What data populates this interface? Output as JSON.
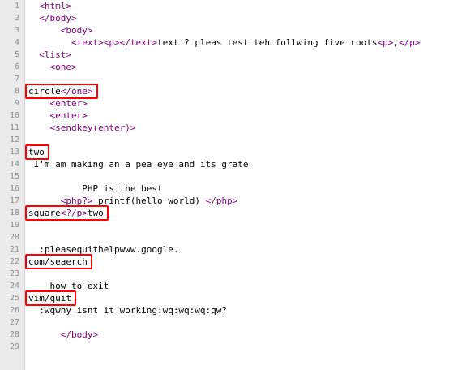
{
  "editor": {
    "colors": {
      "tag": "#800080",
      "text": "#000000",
      "line_number": "#8c8c8c",
      "highlight_box": "#ff0000",
      "gutter": "#ebebeb"
    },
    "highlighted_lines": [
      8,
      13,
      18,
      22,
      25
    ],
    "lines": [
      {
        "n": "1",
        "indent": "  ",
        "segs": [
          {
            "t": "<html>",
            "tag": true
          }
        ]
      },
      {
        "n": "2",
        "indent": "  ",
        "segs": [
          {
            "t": "</body>",
            "tag": true
          }
        ]
      },
      {
        "n": "3",
        "indent": "      ",
        "segs": [
          {
            "t": "<body>",
            "tag": true
          }
        ]
      },
      {
        "n": "4",
        "indent": "        ",
        "segs": [
          {
            "t": "<text>",
            "tag": true
          },
          {
            "t": "<p>",
            "tag": true
          },
          {
            "t": "</text>",
            "tag": true
          },
          {
            "t": "text ? pleas test teh follwing five roots",
            "tag": false
          },
          {
            "t": "<p>",
            "tag": true
          },
          {
            "t": ",",
            "tag": false
          },
          {
            "t": "</p>",
            "tag": true
          }
        ]
      },
      {
        "n": "5",
        "indent": "  ",
        "segs": [
          {
            "t": "<list>",
            "tag": true
          }
        ]
      },
      {
        "n": "6",
        "indent": "    ",
        "segs": [
          {
            "t": "<one>",
            "tag": true
          }
        ]
      },
      {
        "n": "7",
        "indent": "",
        "segs": []
      },
      {
        "n": "8",
        "indent": "",
        "segs": [
          {
            "t": "circle",
            "tag": false
          },
          {
            "t": "</one>",
            "tag": true
          }
        ]
      },
      {
        "n": "9",
        "indent": "    ",
        "segs": [
          {
            "t": "<enter>",
            "tag": true
          }
        ]
      },
      {
        "n": "10",
        "indent": "    ",
        "segs": [
          {
            "t": "<enter>",
            "tag": true
          }
        ]
      },
      {
        "n": "11",
        "indent": "    ",
        "segs": [
          {
            "t": "<sendkey(enter)>",
            "tag": true
          }
        ]
      },
      {
        "n": "12",
        "indent": "",
        "segs": []
      },
      {
        "n": "13",
        "indent": "",
        "segs": [
          {
            "t": "two",
            "tag": false
          }
        ]
      },
      {
        "n": "14",
        "indent": " ",
        "segs": [
          {
            "t": "I'm am making an a pea eye and its grate",
            "tag": false
          }
        ]
      },
      {
        "n": "15",
        "indent": "",
        "segs": []
      },
      {
        "n": "16",
        "indent": "          ",
        "segs": [
          {
            "t": "PHP is the best",
            "tag": false
          }
        ]
      },
      {
        "n": "17",
        "indent": "      ",
        "segs": [
          {
            "t": "<php?>",
            "tag": true
          },
          {
            "t": " printf(hello world) ",
            "tag": false
          },
          {
            "t": "</php>",
            "tag": true
          }
        ]
      },
      {
        "n": "18",
        "indent": "",
        "segs": [
          {
            "t": "square",
            "tag": false
          },
          {
            "t": "<?/p>",
            "tag": true
          },
          {
            "t": "two",
            "tag": false
          }
        ]
      },
      {
        "n": "19",
        "indent": "",
        "segs": []
      },
      {
        "n": "20",
        "indent": "",
        "segs": []
      },
      {
        "n": "21",
        "indent": "  ",
        "segs": [
          {
            "t": ":pleasequithelpwww.google.",
            "tag": false
          }
        ]
      },
      {
        "n": "22",
        "indent": "",
        "segs": [
          {
            "t": "com/seaerch",
            "tag": false
          }
        ]
      },
      {
        "n": "23",
        "indent": "",
        "segs": []
      },
      {
        "n": "24",
        "indent": "    ",
        "segs": [
          {
            "t": "how to exit",
            "tag": false
          }
        ]
      },
      {
        "n": "25",
        "indent": "",
        "segs": [
          {
            "t": "vim/quit",
            "tag": false
          }
        ]
      },
      {
        "n": "26",
        "indent": "  ",
        "segs": [
          {
            "t": ":wqwhy isnt it working:wq:wq:wq:qw?",
            "tag": false
          }
        ]
      },
      {
        "n": "27",
        "indent": "",
        "segs": []
      },
      {
        "n": "28",
        "indent": "      ",
        "segs": [
          {
            "t": "</body>",
            "tag": true
          }
        ]
      },
      {
        "n": "29",
        "indent": "",
        "segs": []
      }
    ]
  }
}
